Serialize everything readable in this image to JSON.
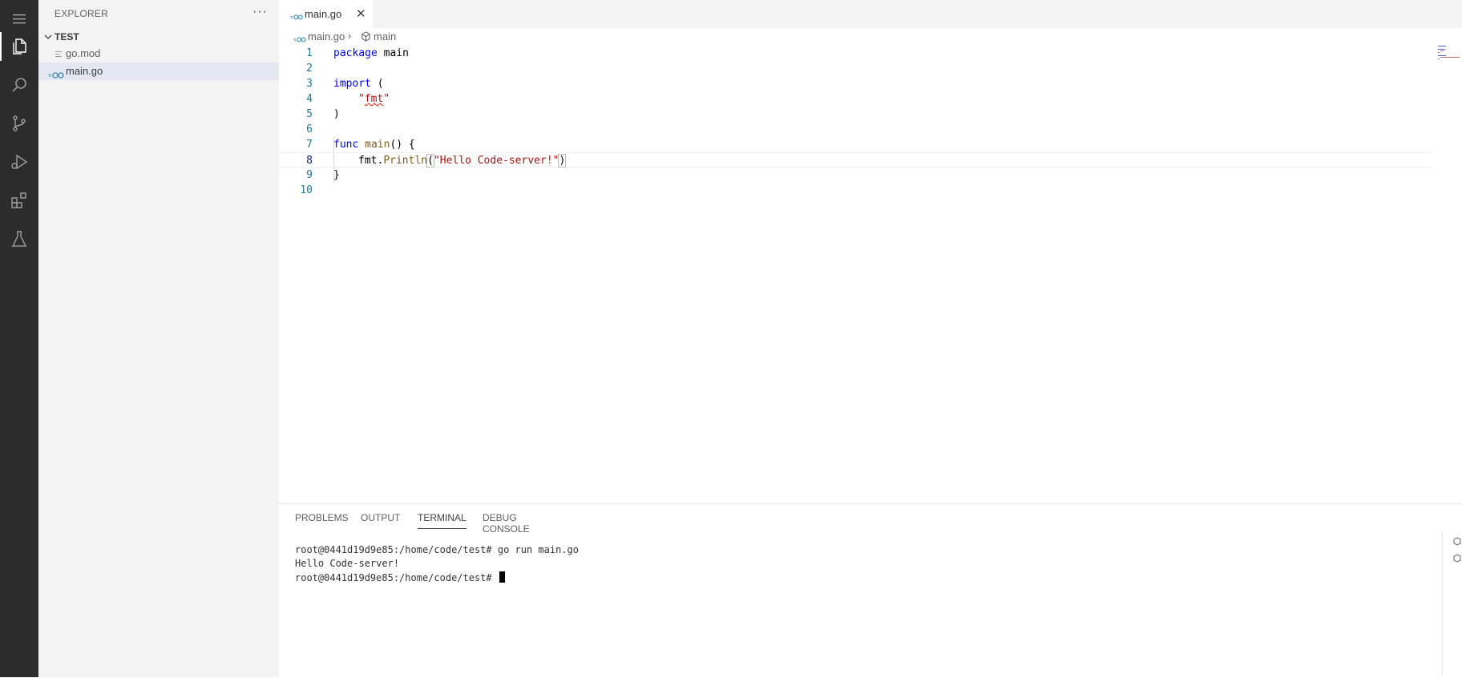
{
  "activity_bar": {
    "items": [
      "menu-icon",
      "explorer-icon",
      "search-icon",
      "source-control-icon",
      "run-debug-icon",
      "extensions-icon",
      "testing-icon"
    ]
  },
  "sidebar": {
    "title": "EXPLORER",
    "more": "···",
    "folder": "TEST",
    "files": [
      {
        "name": "go.mod"
      },
      {
        "name": "main.go"
      }
    ]
  },
  "tabs": [
    {
      "label": "main.go",
      "close": "✕"
    }
  ],
  "breadcrumb": {
    "file": "main.go",
    "separator": "›",
    "symbol": "main"
  },
  "code": {
    "line_numbers": [
      "1",
      "2",
      "3",
      "4",
      "5",
      "6",
      "7",
      "8",
      "9",
      "10"
    ],
    "l1_kw": "package",
    "l1_name": " main",
    "l3_kw": "import",
    "l3_paren": " (",
    "l4_quote_open": "\"",
    "l4_pkg": "fmt",
    "l4_quote_close": "\"",
    "l5": ")",
    "l7_kw": "func",
    "l7_fn": "main",
    "l7_rest": "() {",
    "l8_obj": "fmt.",
    "l8_fn": "Println",
    "l8_open": "(",
    "l8_str": "\"Hello Code-server!\"",
    "l8_close": ")",
    "l9": "}"
  },
  "panel": {
    "tabs": [
      "PROBLEMS",
      "OUTPUT",
      "TERMINAL",
      "DEBUG CONSOLE"
    ],
    "active_tab": "TERMINAL",
    "terminal_lines": [
      "root@0441d19d9e85:/home/code/test# go run main.go",
      "Hello Code-server!",
      "root@0441d19d9e85:/home/code/test# "
    ]
  },
  "colors": {
    "activity_bar": "#2c2c2c",
    "sidebar": "#f3f3f3",
    "keyword": "#0000ff",
    "string": "#a31515",
    "function": "#795e26",
    "line_number": "#237893"
  }
}
